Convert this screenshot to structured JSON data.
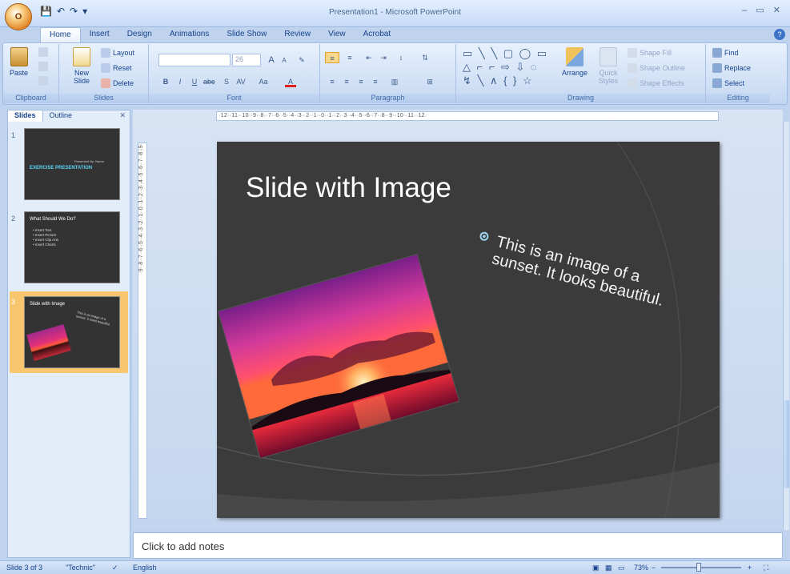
{
  "app": {
    "office_button_label": "O",
    "title": "Presentation1 - Microsoft PowerPoint",
    "window_controls": "– ▭ ✕",
    "help": "?"
  },
  "qat": {
    "save": "💾",
    "undo": "↶",
    "redo": "↷",
    "more": "▾"
  },
  "tabs": [
    {
      "label": "Home",
      "active": true
    },
    {
      "label": "Insert"
    },
    {
      "label": "Design"
    },
    {
      "label": "Animations"
    },
    {
      "label": "Slide Show"
    },
    {
      "label": "Review"
    },
    {
      "label": "View"
    },
    {
      "label": "Acrobat"
    }
  ],
  "ribbon": {
    "clipboard": {
      "label": "Clipboard",
      "paste": "Paste"
    },
    "slides": {
      "label": "Slides",
      "new_slide": "New Slide",
      "layout": "Layout",
      "reset": "Reset",
      "delete": "Delete"
    },
    "font": {
      "label": "Font",
      "font_name": "",
      "font_size": "26",
      "grow": "A",
      "shrink": "A",
      "bold": "B",
      "italic": "I",
      "underline": "U",
      "strike": "abc",
      "shadow": "S",
      "spacing": "AV",
      "case": "Aa",
      "color": "A"
    },
    "paragraph": {
      "label": "Paragraph"
    },
    "drawing": {
      "label": "Drawing",
      "arrange": "Arrange",
      "quick_styles": "Quick Styles",
      "shape_fill": "Shape Fill",
      "shape_outline": "Shape Outline",
      "shape_effects": "Shape Effects",
      "shapes_row1": "▭ ╲ ╲ ▢ ◯ ▭",
      "shapes_row2": "△ ⌐ ⌐ ⇨ ⇩ ◌",
      "shapes_row3": "↯ ╲ ∧ { } ☆"
    },
    "editing": {
      "label": "Editing",
      "find": "Find",
      "replace": "Replace",
      "select": "Select"
    }
  },
  "slide_pane": {
    "tabs": [
      {
        "label": "Slides",
        "active": true
      },
      {
        "label": "Outline"
      }
    ],
    "close": "✕",
    "thumbnails": [
      {
        "number": "1",
        "title": "EXERCISE PRESENTATION",
        "subtitle": "Presented By: Name"
      },
      {
        "number": "2",
        "title": "What Should We Do?",
        "bullets": [
          "• Insert Text",
          "• Insert Picture",
          "• Insert Clip Arts",
          "• Insert Charts"
        ]
      },
      {
        "number": "3",
        "title": "Slide with Image",
        "body": "This is an image of a sunset. It looks beautiful."
      }
    ]
  },
  "ruler": {
    "horizontal": "·12··11··10··9··8··7··6··5··4··3··2··1··0··1··2··3··4··5··6··7··8··9··10··11··12·",
    "vertical": "·9··8··7··6··5··4··3··2··1··0··1··2··3··4··5··6··7··8··9·"
  },
  "slide": {
    "title": "Slide with Image",
    "body": "This is an image of a sunset. It looks beautiful."
  },
  "notes": {
    "placeholder": "Click to add notes"
  },
  "status": {
    "slide_counter": "Slide 3 of 3",
    "theme": "\"Technic\"",
    "language": "English",
    "zoom": "73%",
    "zoom_out": "−",
    "zoom_in": "+"
  }
}
